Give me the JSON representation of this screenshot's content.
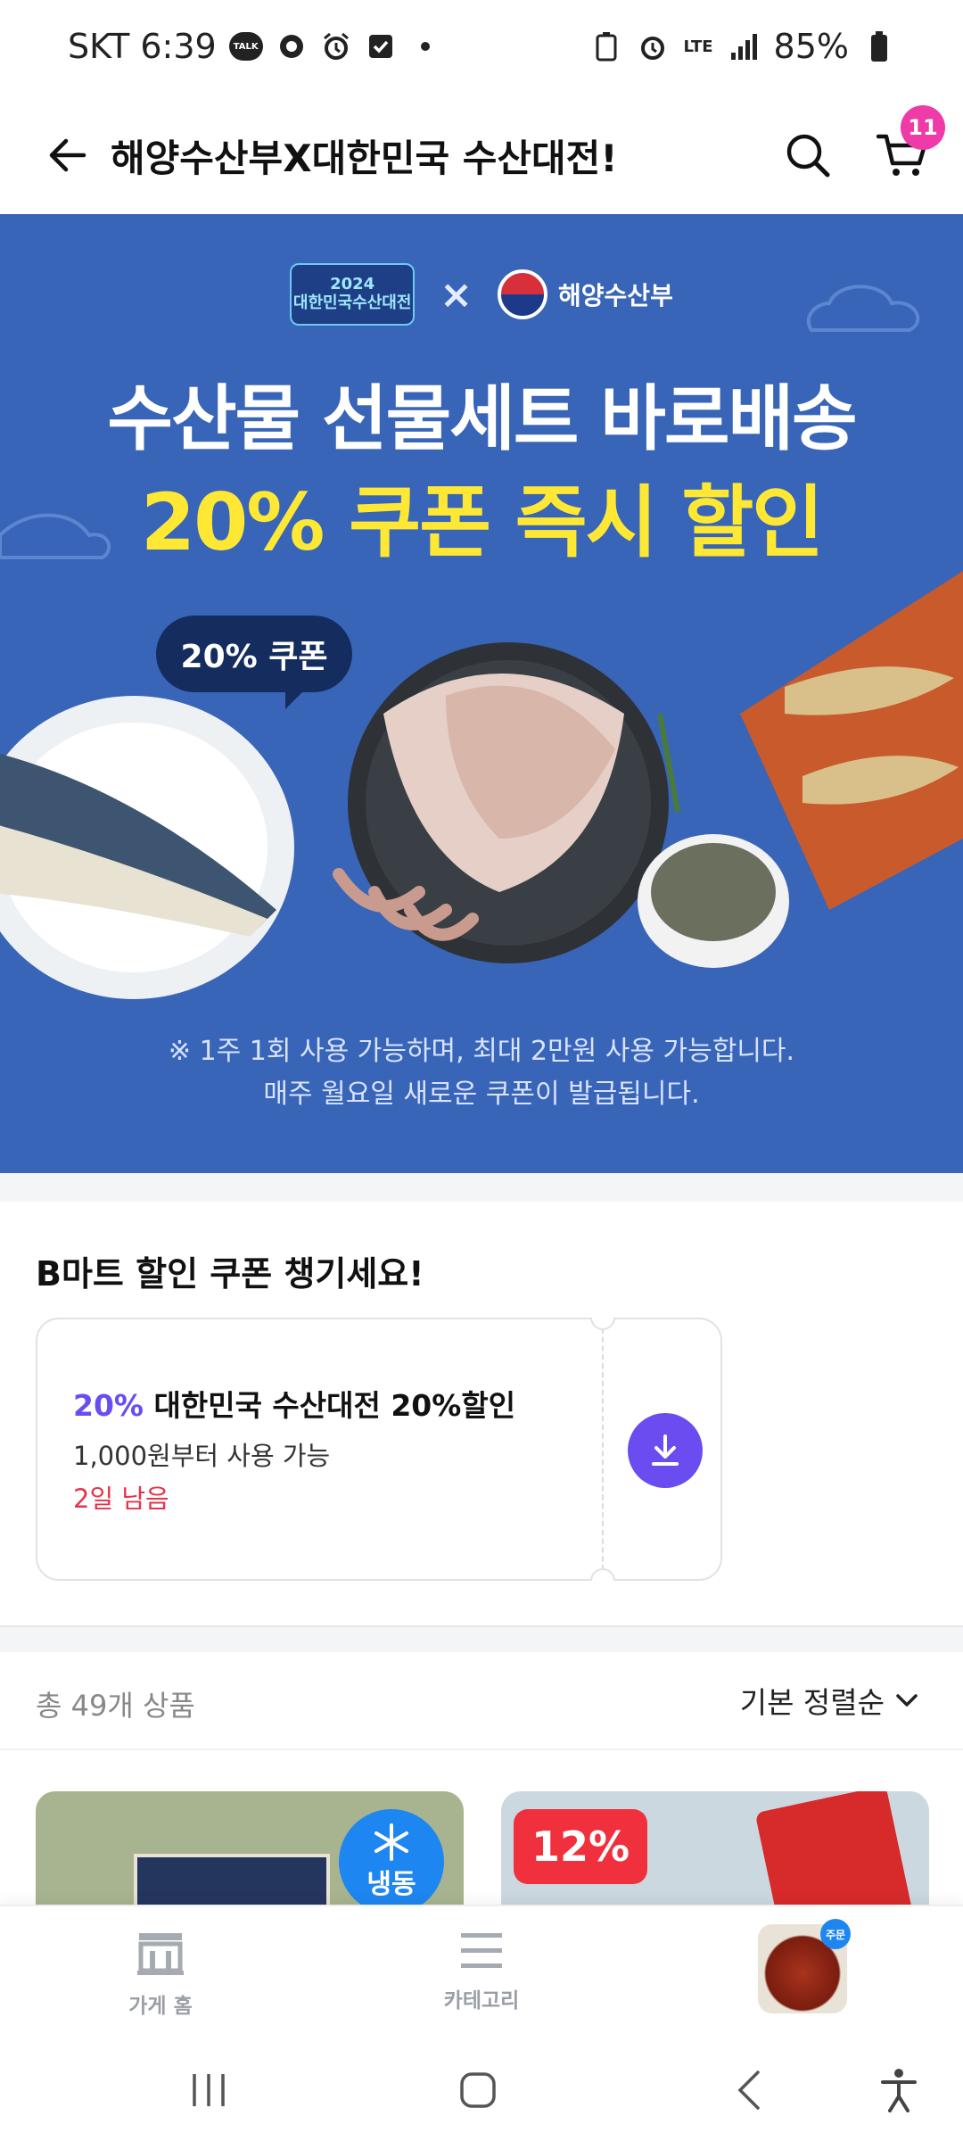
{
  "status_bar": {
    "carrier_time": "SKT 6:39",
    "talk_label": "TALK",
    "network": "LTE",
    "battery": "85%"
  },
  "header": {
    "title": "해양수산부X대한민국 수산대전!",
    "cart_count": "11"
  },
  "banner": {
    "event_logo_year": "2024",
    "event_logo_name": "대한민국수산대전",
    "cross": "×",
    "ministry": "해양수산부",
    "headline": "수산물 선물세트 바로배송",
    "subheadline": "20% 쿠폰 즉시 할인",
    "bubble": "20% 쿠폰",
    "note_line1": "※ 1주 1회 사용 가능하며, 최대 2만원 사용 가능합니다.",
    "note_line2": "매주 월요일 새로운 쿠폰이 발급됩니다."
  },
  "coupon_section": {
    "heading": "B마트 할인 쿠폰 챙기세요!",
    "coupon": {
      "percent": "20%",
      "name": " 대한민국 수산대전 20%할인",
      "minimum": "1,000원부터 사용 가능",
      "remaining": "2일 남음"
    }
  },
  "product_list": {
    "total": "총 49개 상품",
    "sort": "기본 정렬순",
    "products": [
      {
        "badge": "냉동",
        "badge_type": "frozen"
      },
      {
        "badge": "12%",
        "badge_type": "discount"
      }
    ]
  },
  "tab_bar": {
    "home": "가게 홈",
    "category": "카테고리",
    "thumb_badge": "주문"
  },
  "colors": {
    "banner_bg": "#3865b8",
    "headline_yellow": "#ffe834",
    "accent_purple": "#6b4cf0",
    "alert_red": "#e9324a",
    "cart_badge": "#ef3ba7"
  }
}
